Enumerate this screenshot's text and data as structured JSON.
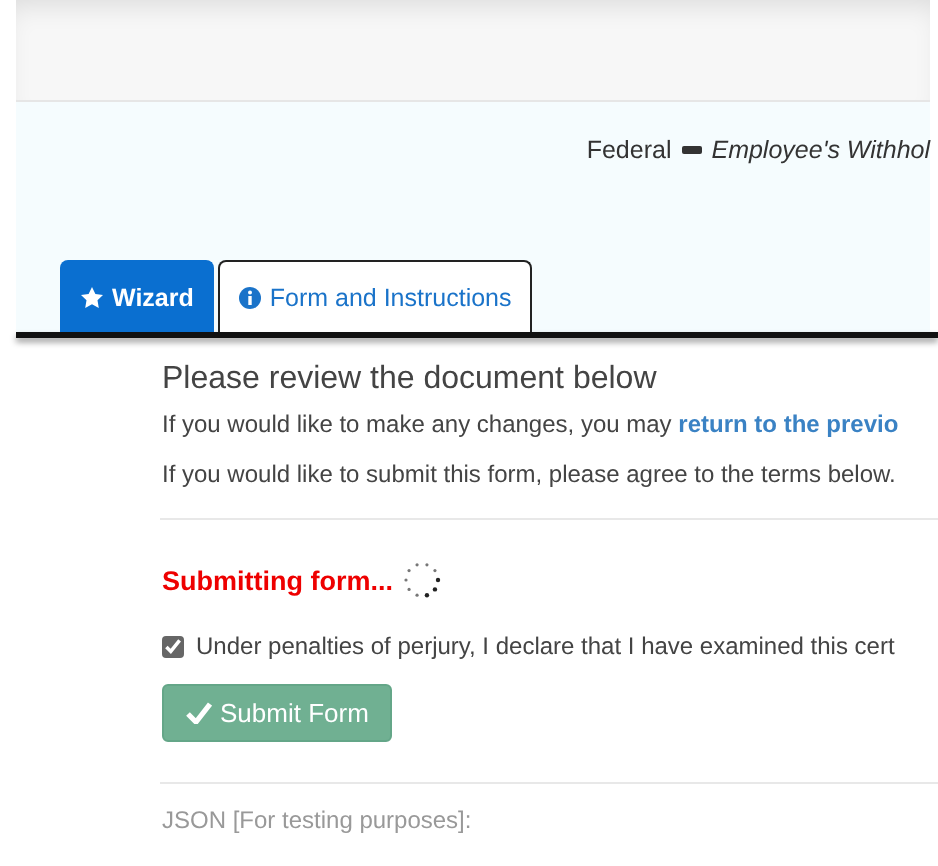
{
  "breadcrumb": {
    "category": "Federal",
    "form": "Employee's Withhol"
  },
  "tabs": [
    {
      "kind": "star",
      "label": "Wizard",
      "selected": true
    },
    {
      "kind": "info",
      "label": "Form and Instructions",
      "selected": false
    }
  ],
  "review": {
    "heading": "Please review the document below",
    "changes_text": "If you would like to make any changes, you may",
    "changes_link": "return to the previo",
    "submit_text": "If you would like to submit this form, please agree to the terms below."
  },
  "status": {
    "text": "Submitting form...",
    "busy": true
  },
  "agreement": {
    "label": "Under penalties of perjury, I declare that I have examined this cert",
    "checked": true
  },
  "submit_button": {
    "label": "Submit Form",
    "disabled": true
  },
  "debug_label": "JSON [For testing purposes]:"
}
